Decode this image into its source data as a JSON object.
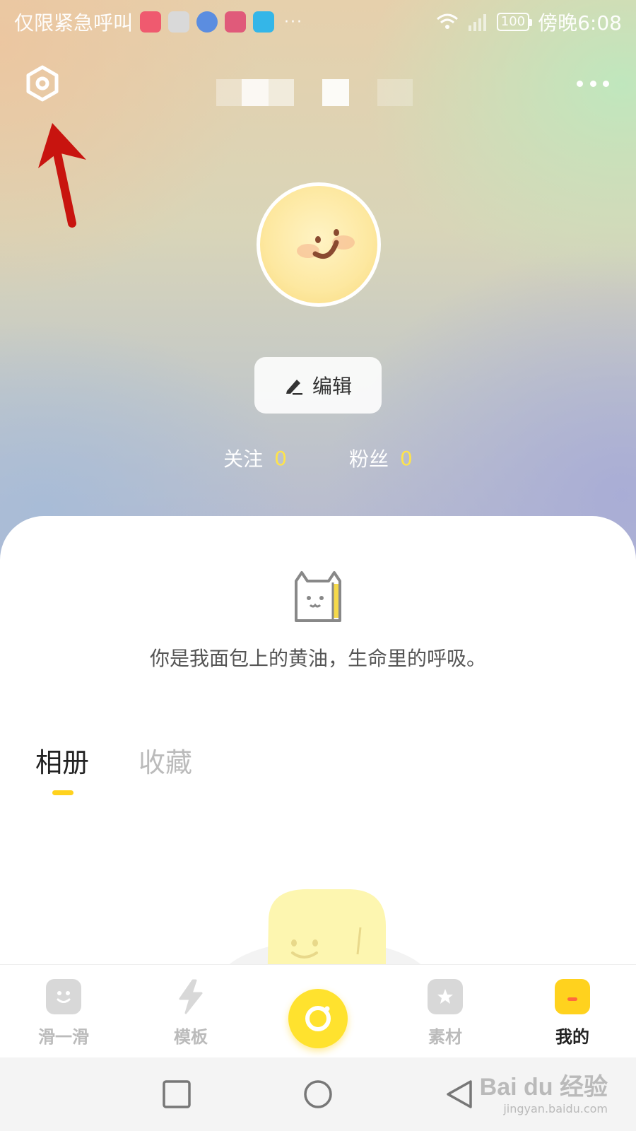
{
  "status_bar": {
    "carrier_text": "仅限紧急呼叫",
    "time": "傍晚6:08",
    "battery": "100",
    "app_icon_colors": [
      "#ef5a6f",
      "#d9d9d9",
      "#5b8de0",
      "#e05a7a",
      "#34b6e8"
    ]
  },
  "header": {
    "settings_icon": "settings-hexagon-icon",
    "more_icon": "more-dots-icon"
  },
  "profile": {
    "edit_label": "编辑",
    "following_label": "关注",
    "following_count": "0",
    "followers_label": "粉丝",
    "followers_count": "0",
    "bio": "你是我面包上的黄油，生命里的呼吸。"
  },
  "tabs": [
    {
      "label": "相册",
      "active": true
    },
    {
      "label": "收藏",
      "active": false
    }
  ],
  "bottom_nav": [
    {
      "label": "滑一滑",
      "icon": "smile-face-icon",
      "active": false
    },
    {
      "label": "模板",
      "icon": "lightning-icon",
      "active": false
    },
    {
      "label": "",
      "icon": "camera-icon",
      "active": false
    },
    {
      "label": "素材",
      "icon": "star-tag-icon",
      "active": false
    },
    {
      "label": "我的",
      "icon": "profile-icon",
      "active": true
    }
  ],
  "colors": {
    "accent": "#ffd21e",
    "count_yellow": "#ffe44a",
    "annotation_red": "#c8140f"
  },
  "watermark": {
    "main": "Bai du 经验",
    "url": "jingyan.baidu.com"
  }
}
